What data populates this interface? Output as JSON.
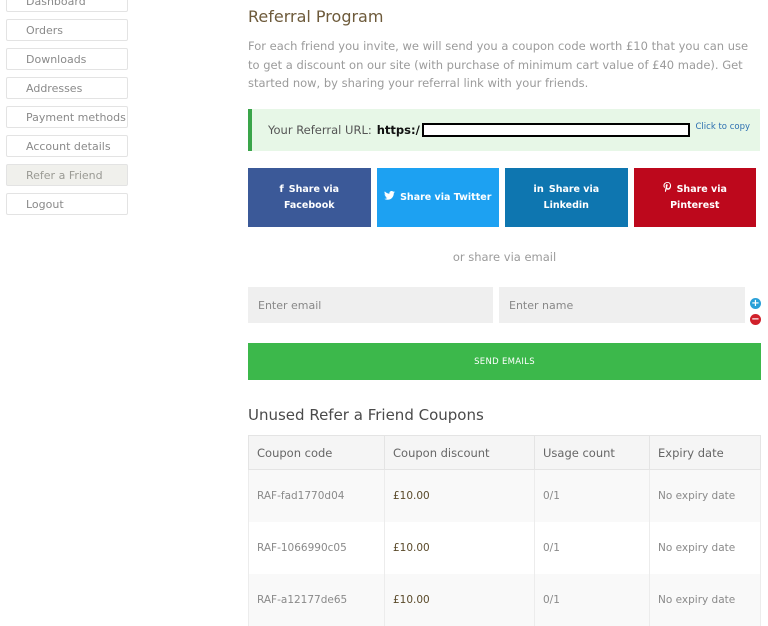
{
  "sidebar": {
    "items": [
      {
        "label": "Dashboard"
      },
      {
        "label": "Orders"
      },
      {
        "label": "Downloads"
      },
      {
        "label": "Addresses"
      },
      {
        "label": "Payment methods"
      },
      {
        "label": "Account details"
      },
      {
        "label": "Refer a Friend"
      },
      {
        "label": "Logout"
      }
    ]
  },
  "main": {
    "title": "Referral Program",
    "intro": "For each friend you invite, we will send you a coupon code worth £10 that you can use to get a discount on our site (with purchase of minimum cart value of £40 made). Get started now, by sharing your referral link with your friends.",
    "referral": {
      "label": "Your Referral URL:",
      "url_prefix": "https:/",
      "copy_label": "Click to copy"
    },
    "share": {
      "facebook": {
        "line1": "Share via",
        "line2": "Facebook",
        "icon": "facebook-icon"
      },
      "twitter": {
        "line1": "Share via Twitter",
        "icon": "twitter-icon"
      },
      "linkedin": {
        "line1": "Share via",
        "line2": "Linkedin",
        "icon": "linkedin-icon"
      },
      "pinterest": {
        "line1": "Share via",
        "line2": "Pinterest",
        "icon": "pinterest-icon"
      }
    },
    "or_email": "or share via email",
    "email_placeholder": "Enter email",
    "name_placeholder": "Enter name",
    "send_label": "SEND EMAILS",
    "coupons_title": "Unused Refer a Friend Coupons",
    "coupons": {
      "headers": [
        "Coupon code",
        "Coupon discount",
        "Usage count",
        "Expiry date"
      ],
      "rows": [
        [
          "RAF-fad1770d04",
          "£10.00",
          "0/1",
          "No expiry date"
        ],
        [
          "RAF-1066990c05",
          "£10.00",
          "0/1",
          "No expiry date"
        ],
        [
          "RAF-a12177de65",
          "£10.00",
          "0/1",
          "No expiry date"
        ]
      ]
    }
  },
  "colors": {
    "facebook": "#3b5998",
    "twitter": "#1da1f2",
    "linkedin": "#0e76b0",
    "pinterest": "#bd081c",
    "send": "#3cb84b",
    "referral_bg": "#e7f7e7"
  }
}
